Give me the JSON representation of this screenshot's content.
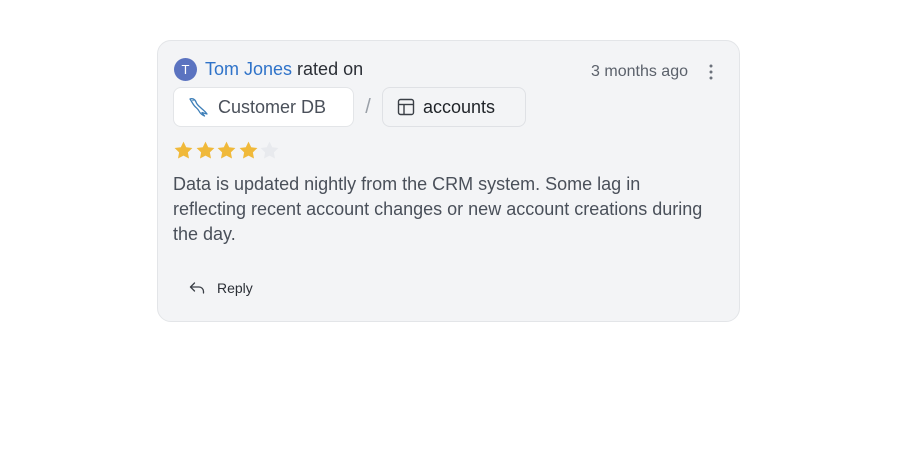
{
  "review": {
    "avatar_initial": "T",
    "author": "Tom Jones",
    "action": "rated on",
    "timestamp": "3 months ago",
    "breadcrumb": {
      "database": "Customer DB",
      "separator": "/",
      "table": "accounts"
    },
    "rating": 4,
    "rating_max": 5,
    "text": "Data is updated nightly from the CRM system. Some lag in reflecting recent account changes or new account creations during the day.",
    "reply_label": "Reply"
  },
  "colors": {
    "star_filled": "#f0b93a",
    "star_empty": "#e8eaee",
    "author_link": "#2f73c9",
    "avatar_bg": "#5b73c0",
    "card_bg": "#f3f4f6"
  },
  "icons": {
    "database": "mysql-dolphin-icon",
    "table": "table-grid-icon",
    "menu": "kebab-vertical-icon",
    "reply": "reply-arrow-icon",
    "star": "star-icon"
  }
}
